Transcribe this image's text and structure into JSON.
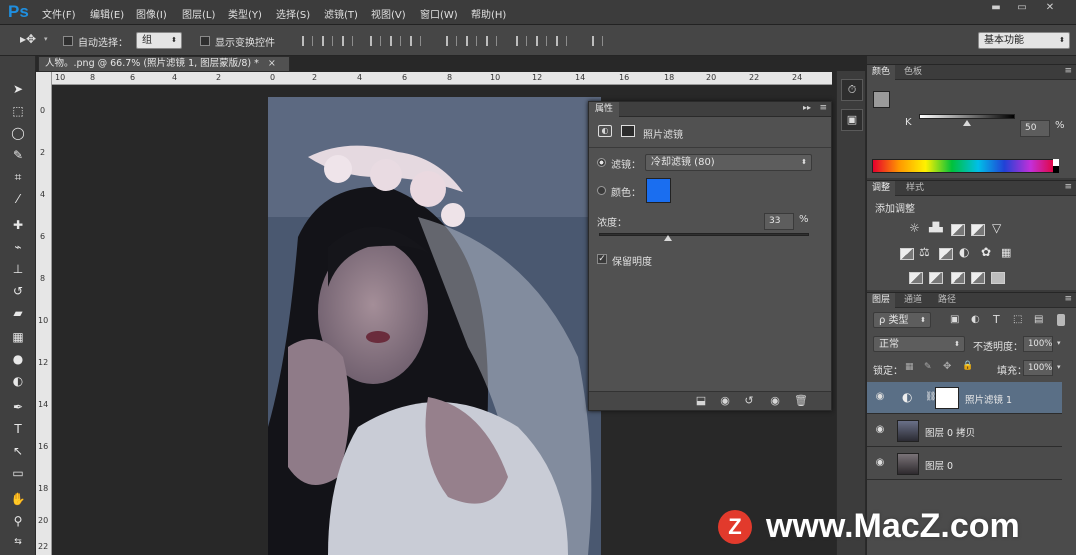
{
  "app": {
    "logo": "Ps",
    "menus": [
      "文件(F)",
      "编辑(E)",
      "图像(I)",
      "图层(L)",
      "类型(Y)",
      "选择(S)",
      "滤镜(T)",
      "视图(V)",
      "窗口(W)",
      "帮助(H)"
    ],
    "window_controls": [
      "▬",
      "▭",
      "✕"
    ]
  },
  "options_bar": {
    "auto_select_label": "自动选择：",
    "auto_select_value": "组",
    "show_transform_label": "显示变换控件",
    "workspace": "基本功能"
  },
  "document": {
    "tab_title": "人物。.png @ 66.7% (照片滤镜 1, 图层蒙版/8) *",
    "close_glyph": "×",
    "ruler_h": [
      "10",
      "8",
      "6",
      "4",
      "2",
      "0",
      "2",
      "4",
      "6",
      "8",
      "10",
      "12",
      "14",
      "16",
      "18",
      "20",
      "22",
      "24"
    ],
    "ruler_v": [
      "0",
      "2",
      "4",
      "6",
      "8",
      "10",
      "12",
      "14",
      "16",
      "18",
      "20",
      "22"
    ]
  },
  "properties_panel": {
    "tab": "属性",
    "title": "照片滤镜",
    "filter_label": "滤镜：",
    "filter_value": "冷却滤镜 (80)",
    "color_label": "颜色：",
    "color_value": "#1a6ef0",
    "density_label": "浓度：",
    "density_value": "33",
    "density_unit": "%",
    "density_level": 0.33,
    "preserve_luminosity_label": "保留明度",
    "preserve_luminosity_checked": true
  },
  "color_panel": {
    "tabs": [
      "颜色",
      "色板"
    ],
    "channel_label": "K",
    "channel_value": "50",
    "channel_unit": "%",
    "channel_level": 0.5
  },
  "adjustments_panel": {
    "tabs": [
      "调整",
      "样式"
    ],
    "title": "添加调整"
  },
  "layers_panel": {
    "tabs": [
      "图层",
      "通道",
      "路径"
    ],
    "kind_filter": "ρ 类型",
    "blend_mode": "正常",
    "opacity_label": "不透明度：",
    "opacity_value": "100%",
    "lock_label": "锁定：",
    "fill_label": "填充：",
    "fill_value": "100%",
    "layers": [
      {
        "name": "照片滤镜 1",
        "selected": true
      },
      {
        "name": "图层 0 拷贝",
        "selected": false
      },
      {
        "name": "图层 0",
        "selected": false
      }
    ]
  },
  "watermark": {
    "badge": "Z",
    "text": "www.MacZ.com"
  }
}
